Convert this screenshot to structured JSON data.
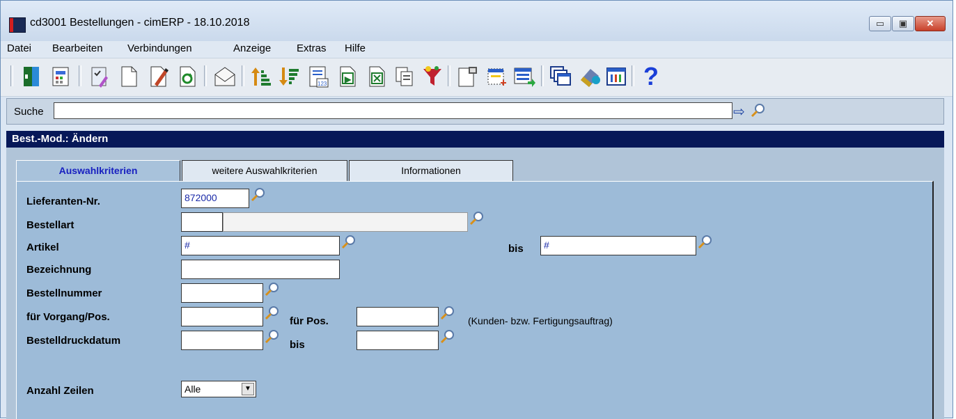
{
  "window": {
    "title": "cd3001 Bestellungen - cimERP - 18.10.2018",
    "controls": {
      "minimize": "▭",
      "maximize": "▣",
      "close": "✕"
    }
  },
  "menu": {
    "items": [
      "Datei",
      "Bearbeiten",
      "Verbindungen",
      "Anzeige",
      "Extras",
      "Hilfe"
    ]
  },
  "toolbar": {
    "icons": [
      "exit-icon",
      "calculator-icon",
      "checklist-icon",
      "new-document-icon",
      "edit-icon",
      "refresh-icon",
      "mail-icon",
      "sort-ascending-icon",
      "sort-descending-icon",
      "numbered-list-icon",
      "export-icon",
      "excel-icon",
      "copy-icon",
      "filter-icon",
      "properties-icon",
      "add-window-icon",
      "import-icon",
      "windows-icon",
      "book-icon",
      "table-icon",
      "help-icon"
    ]
  },
  "search": {
    "label": "Suche",
    "value": ""
  },
  "mode_header": "Best.-Mod.: Ändern",
  "tabs": [
    {
      "label": "Auswahlkriterien",
      "active": true
    },
    {
      "label": "weitere Auswahlkriterien",
      "active": false
    },
    {
      "label": "Informationen",
      "active": false
    }
  ],
  "form": {
    "lieferant_label": "Lieferanten-Nr.",
    "lieferant_value": "872000",
    "bestellart_label": "Bestellart",
    "bestellart_code": "",
    "bestellart_desc": "",
    "artikel_label": "Artikel",
    "artikel_from": "#",
    "artikel_bis_label": "bis",
    "artikel_to": "#",
    "bezeichnung_label": "Bezeichnung",
    "bezeichnung_value": "",
    "bestellnummer_label": "Bestellnummer",
    "bestellnummer_value": "",
    "vorgang_label": "für Vorgang/Pos.",
    "vorgang_value": "",
    "fuer_pos_label": "für Pos.",
    "fuer_pos_value": "",
    "vorgang_hint": "(Kunden- bzw. Fertigungsauftrag)",
    "druckdatum_label": "Bestelldruckdatum",
    "druckdatum_from": "",
    "druckdatum_bis_label": "bis",
    "druckdatum_to": "",
    "zeilen_label": "Anzahl Zeilen",
    "zeilen_value": "Alle"
  },
  "colors": {
    "header_bg": "#071858",
    "panel_bg": "#9dbbd8",
    "active_tab_text": "#1820c0"
  }
}
